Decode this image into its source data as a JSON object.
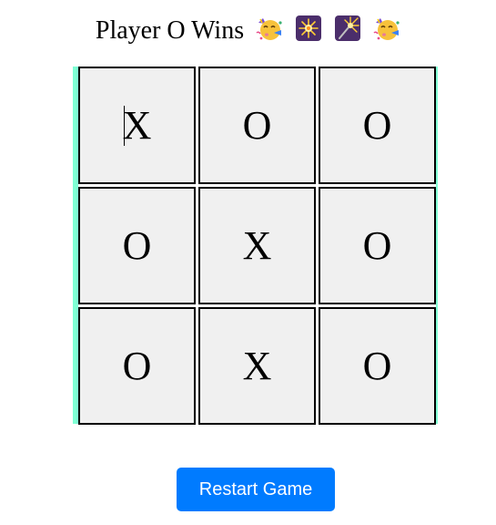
{
  "status": {
    "text": "Player O Wins",
    "emojis": [
      "partying-face-icon",
      "sparkler-icon",
      "sparkler-icon",
      "partying-face-icon"
    ]
  },
  "board": {
    "cells": [
      "X",
      "O",
      "O",
      "O",
      "X",
      "O",
      "O",
      "X",
      "O"
    ],
    "winner": "O"
  },
  "controls": {
    "restart_label": "Restart Game"
  },
  "colors": {
    "board_accent": "#7fffd4",
    "cell_background": "#f0f0f0",
    "button": "#007bff"
  }
}
